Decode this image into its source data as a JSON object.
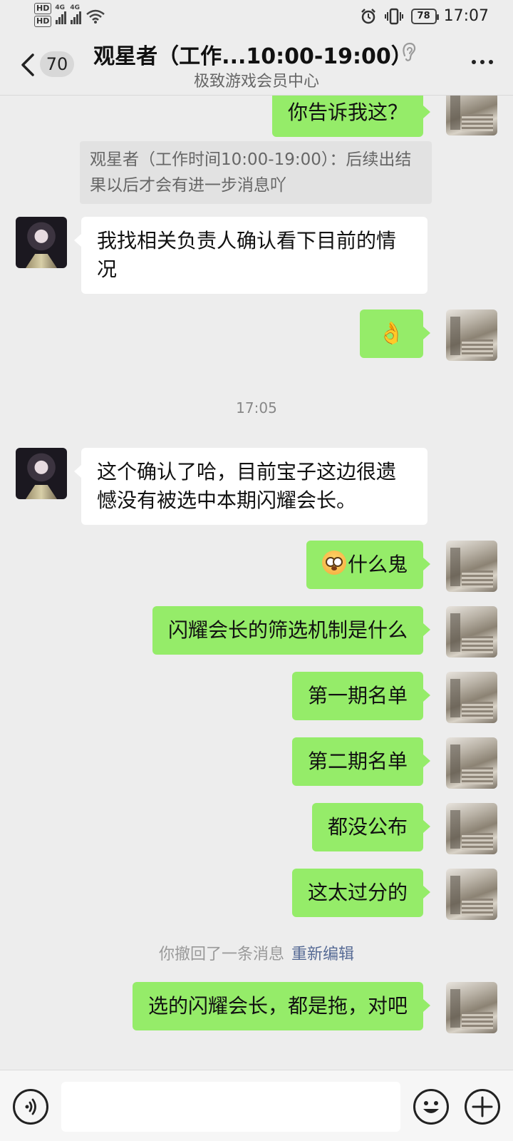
{
  "status_bar": {
    "hd1": "HD",
    "hd2": "HD",
    "net1": "4G",
    "net2": "4G",
    "battery": "78",
    "time": "17:07"
  },
  "header": {
    "unread_count": "70",
    "title": "观星者（工作...10:00-19:00）",
    "subtitle": "极致游戏会员中心"
  },
  "messages": {
    "m1": "你告诉我这？",
    "quote": "观星者（工作时间10:00-19:00）：后续出结果以后才会有进一步消息吖",
    "m2": "我找相关负责人确认看下目前的情况",
    "m3": "👌",
    "timestamp": "17:05",
    "m4": "这个确认了哈，目前宝子这边很遗憾没有被选中本期闪耀会长。",
    "m5": "什么鬼",
    "m6": "闪耀会长的筛选机制是什么",
    "m7": "第一期名单",
    "m8": "第二期名单",
    "m9": "都没公布",
    "m10": "这太过分的",
    "recall_text": "你撤回了一条消息",
    "recall_link": "重新编辑",
    "m11": "选的闪耀会长，都是拖，对吧"
  },
  "icons": {
    "back": "chevron-left-icon",
    "ear": "ear-icon",
    "more": "more-dots-icon",
    "voice": "voice-icon",
    "emoji": "emoji-icon",
    "plus": "plus-icon"
  },
  "colors": {
    "self_bubble": "#95ec69",
    "other_bubble": "#ffffff",
    "background": "#ededed",
    "link": "#576b95"
  }
}
